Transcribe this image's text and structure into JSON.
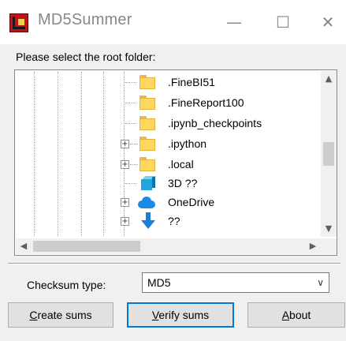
{
  "window": {
    "title": "MD5Summer",
    "minimize_glyph": "—",
    "maximize_glyph": "☐",
    "close_glyph": "✕"
  },
  "prompt": "Please select the root folder:",
  "tree": {
    "nodes": [
      {
        "label": ".FineBI51",
        "icon": "folder-icon",
        "expandable": false
      },
      {
        "label": ".FineReport100",
        "icon": "folder-icon",
        "expandable": false
      },
      {
        "label": ".ipynb_checkpoints",
        "icon": "folder-icon",
        "expandable": false
      },
      {
        "label": ".ipython",
        "icon": "folder-icon",
        "expandable": true
      },
      {
        "label": ".local",
        "icon": "folder-icon",
        "expandable": true
      },
      {
        "label": "3D ??",
        "icon": "3d-objects-icon",
        "expandable": false
      },
      {
        "label": "OneDrive",
        "icon": "onedrive-cloud-icon",
        "expandable": true
      },
      {
        "label": "??",
        "icon": "downloads-arrow-icon",
        "expandable": true
      }
    ],
    "expander_glyph": "+",
    "scroll_up_glyph": "▲",
    "scroll_down_glyph": "▼",
    "scroll_left_glyph": "◀",
    "scroll_right_glyph": "▶"
  },
  "checksum": {
    "label": "Checksum type:",
    "value": "MD5",
    "dropdown_glyph": "∨"
  },
  "buttons": {
    "create_mnemonic": "C",
    "create_rest": "reate sums",
    "verify_mnemonic": "V",
    "verify_rest": "erify sums",
    "about_mnemonic": "A",
    "about_rest": "bout"
  },
  "colors": {
    "accent": "#0078d7",
    "folder": "#ffd75e",
    "app_icon": "#c1121a"
  }
}
